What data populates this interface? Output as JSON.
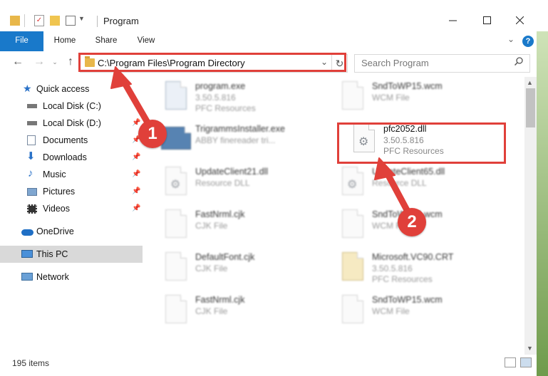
{
  "window": {
    "title": "Program",
    "status_count": "195 items"
  },
  "ribbon": {
    "tabs": [
      "File",
      "Home",
      "Share",
      "View"
    ],
    "help_label": "?"
  },
  "address": {
    "path": "C:\\Program Files\\Program Directory",
    "search_placeholder": "Search Program"
  },
  "sidebar": {
    "items": [
      {
        "label": "Quick access",
        "icon": "star-icon"
      },
      {
        "label": "Local Disk (C:)",
        "icon": "drive-icon"
      },
      {
        "label": "Local Disk (D:)",
        "icon": "drive-icon"
      },
      {
        "label": "Documents",
        "icon": "documents-icon"
      },
      {
        "label": "Downloads",
        "icon": "download-icon"
      },
      {
        "label": "Music",
        "icon": "music-icon"
      },
      {
        "label": "Pictures",
        "icon": "pictures-icon"
      },
      {
        "label": "Videos",
        "icon": "videos-icon"
      },
      {
        "label": "OneDrive",
        "icon": "cloud-icon"
      },
      {
        "label": "This PC",
        "icon": "computer-icon"
      },
      {
        "label": "Network",
        "icon": "network-icon"
      }
    ]
  },
  "files": [
    {
      "name": "program.exe",
      "line2": "3.50.5.816",
      "line3": "PFC Resources"
    },
    {
      "name": "SndToWP15.wcm",
      "line2": "WCM File",
      "line3": ""
    },
    {
      "name": "TrigrammsInstaller.exe",
      "line2": "ABBY finereader tri...",
      "line3": ""
    },
    {
      "name": "pfc2052.dll",
      "line2": "3.50.5.816",
      "line3": "PFC Resources"
    },
    {
      "name": "UpdateClient21.dll",
      "line2": "Resource DLL",
      "line3": ""
    },
    {
      "name": "UpdateClient65.dll",
      "line2": "Resource DLL",
      "line3": ""
    },
    {
      "name": "FastNrml.cjk",
      "line2": "CJK File",
      "line3": ""
    },
    {
      "name": "SndToWP15.wcm",
      "line2": "WCM File",
      "line3": ""
    },
    {
      "name": "DefaultFont.cjk",
      "line2": "CJK File",
      "line3": ""
    },
    {
      "name": "Microsoft.VC90.CRT",
      "line2": "3.50.5.816",
      "line3": "PFC Resources"
    },
    {
      "name": "FastNrml.cjk",
      "line2": "CJK File",
      "line3": ""
    },
    {
      "name": "SndToWP15.wcm",
      "line2": "WCM File",
      "line3": ""
    }
  ],
  "annotations": {
    "badge1": "1",
    "badge2": "2"
  },
  "colors": {
    "accent": "#1979ca",
    "annotation_red": "#e0403a",
    "selected_nav": "#d9d9d9"
  }
}
